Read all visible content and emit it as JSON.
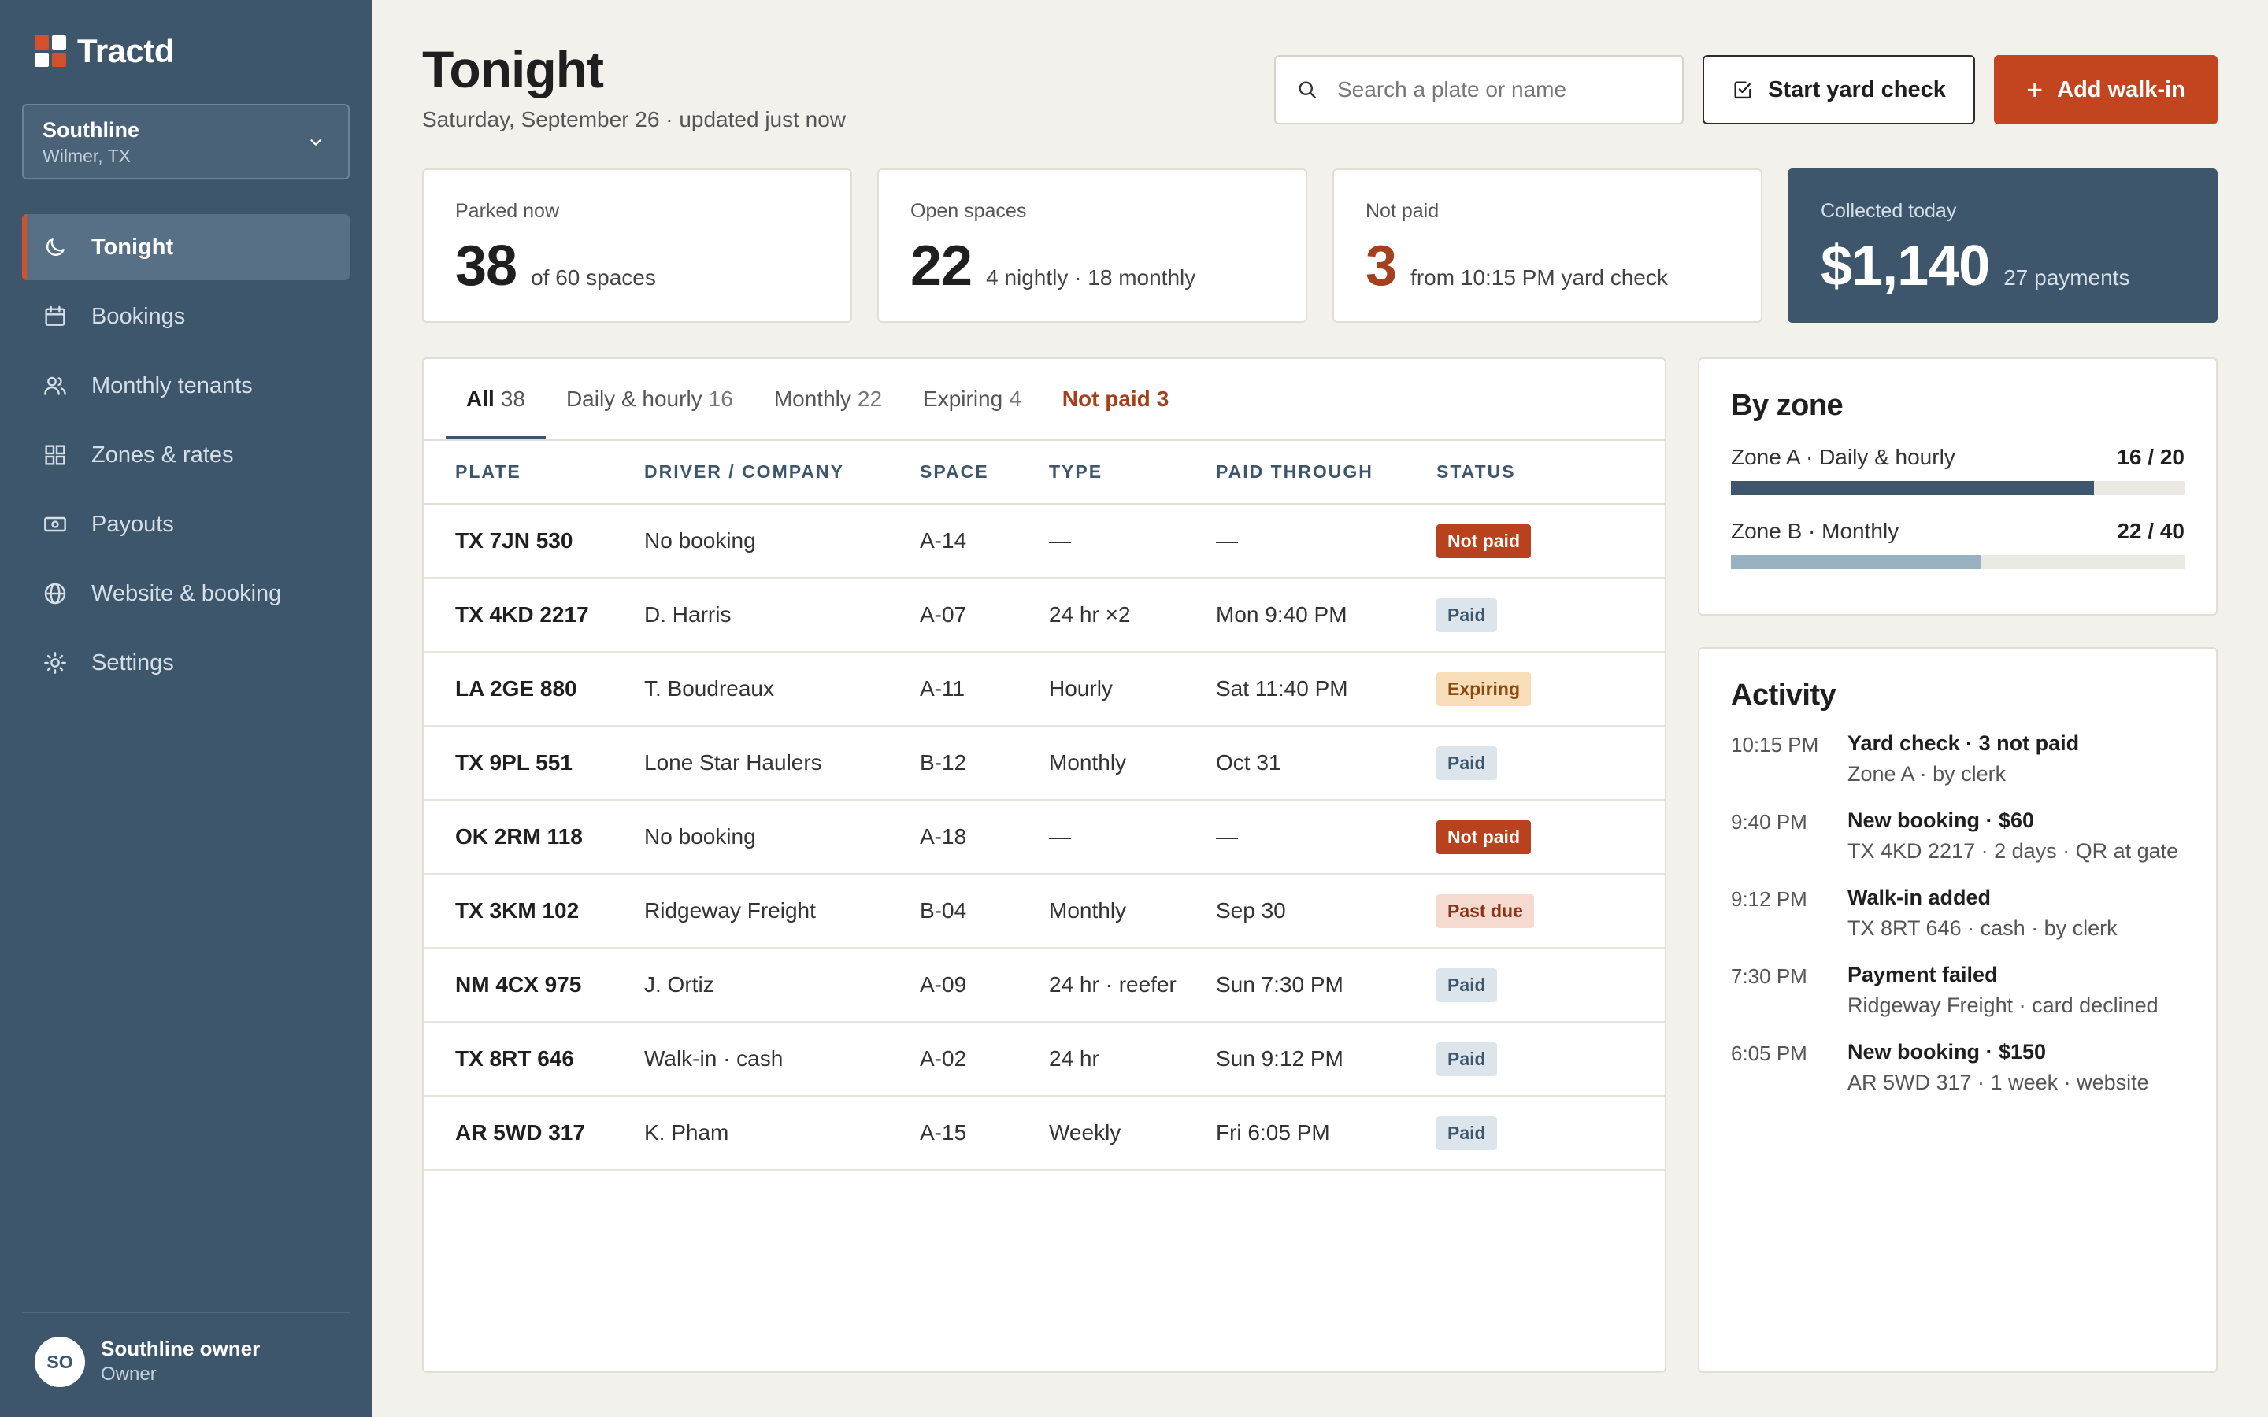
{
  "brand": {
    "name": "Tractd"
  },
  "site": {
    "name": "Southline",
    "location": "Wilmer, TX"
  },
  "nav": [
    {
      "label": "Tonight",
      "icon": "moon-icon",
      "active": true
    },
    {
      "label": "Bookings",
      "icon": "calendar-icon"
    },
    {
      "label": "Monthly tenants",
      "icon": "users-icon"
    },
    {
      "label": "Zones & rates",
      "icon": "grid-icon"
    },
    {
      "label": "Payouts",
      "icon": "cash-icon"
    },
    {
      "label": "Website & booking",
      "icon": "globe-icon"
    },
    {
      "label": "Settings",
      "icon": "sun-icon"
    }
  ],
  "user": {
    "initials": "SO",
    "name": "Southline owner",
    "role": "Owner"
  },
  "header": {
    "title": "Tonight",
    "subtitle": "Saturday, September 26 · updated just now",
    "search_placeholder": "Search a plate or name",
    "yard_check_label": "Start yard check",
    "add_walkin_label": "Add walk-in"
  },
  "stats": [
    {
      "label": "Parked now",
      "value": "38",
      "note": "of 60 spaces"
    },
    {
      "label": "Open spaces",
      "value": "22",
      "note": "4 nightly · 18 monthly"
    },
    {
      "label": "Not paid",
      "value": "3",
      "note": "from 10:15 PM yard check"
    },
    {
      "label": "Collected today",
      "value": "$1,140",
      "note": "27 payments"
    }
  ],
  "tabs": [
    {
      "label": "All",
      "count": "38"
    },
    {
      "label": "Daily & hourly",
      "count": "16"
    },
    {
      "label": "Monthly",
      "count": "22"
    },
    {
      "label": "Expiring",
      "count": "4"
    },
    {
      "label": "Not paid",
      "count": "3"
    }
  ],
  "table": {
    "columns": [
      "PLATE",
      "DRIVER / COMPANY",
      "SPACE",
      "TYPE",
      "PAID THROUGH",
      "STATUS"
    ],
    "rows": [
      [
        "TX 7JN 530",
        "No booking",
        "A-14",
        "—",
        "—",
        "Not paid"
      ],
      [
        "TX 4KD 2217",
        "D. Harris",
        "A-07",
        "24 hr ×2",
        "Mon 9:40 PM",
        "Paid"
      ],
      [
        "LA 2GE 880",
        "T. Boudreaux",
        "A-11",
        "Hourly",
        "Sat 11:40 PM",
        "Expiring"
      ],
      [
        "TX 9PL 551",
        "Lone Star Haulers",
        "B-12",
        "Monthly",
        "Oct 31",
        "Paid"
      ],
      [
        "OK 2RM 118",
        "No booking",
        "A-18",
        "—",
        "—",
        "Not paid"
      ],
      [
        "TX 3KM 102",
        "Ridgeway Freight",
        "B-04",
        "Monthly",
        "Sep 30",
        "Past due"
      ],
      [
        "NM 4CX 975",
        "J. Ortiz",
        "A-09",
        "24 hr · reefer",
        "Sun 7:30 PM",
        "Paid"
      ],
      [
        "TX 8RT 646",
        "Walk-in · cash",
        "A-02",
        "24 hr",
        "Sun 9:12 PM",
        "Paid"
      ],
      [
        "AR 5WD 317",
        "K. Pham",
        "A-15",
        "Weekly",
        "Fri 6:05 PM",
        "Paid"
      ]
    ]
  },
  "zones": {
    "title": "By zone",
    "items": [
      {
        "name": "Zone A · Daily & hourly",
        "value": "16 / 20",
        "fraction": 0.8,
        "color": "#3d566c"
      },
      {
        "name": "Zone B · Monthly",
        "value": "22 / 40",
        "fraction": 0.55,
        "color": "#98b1c3"
      }
    ]
  },
  "activity": {
    "title": "Activity",
    "items": [
      {
        "time": "10:15 PM",
        "title": "Yard check · 3 not paid",
        "desc": "Zone A · by clerk"
      },
      {
        "time": "9:40 PM",
        "title": "New booking · $60",
        "desc": "TX 4KD 2217 · 2 days · QR at gate"
      },
      {
        "time": "9:12 PM",
        "title": "Walk-in added",
        "desc": "TX 8RT 646 · cash · by clerk"
      },
      {
        "time": "7:30 PM",
        "title": "Payment failed",
        "desc": "Ridgeway Freight · card declined"
      },
      {
        "time": "6:05 PM",
        "title": "New booking · $150",
        "desc": "AR 5WD 317 · 1 week · website"
      }
    ]
  },
  "colors": {
    "sidebar": "#3d566c",
    "accent": "#c2451f",
    "alert": "#a5401e"
  }
}
